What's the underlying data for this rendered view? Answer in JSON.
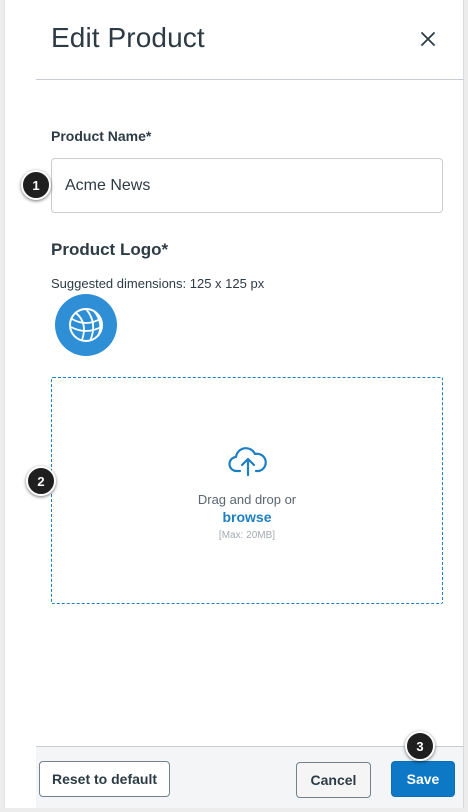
{
  "dialog": {
    "title": "Edit Product",
    "close_label": "×"
  },
  "form": {
    "product_name": {
      "label": "Product Name*",
      "value": "Acme News"
    },
    "product_logo": {
      "label": "Product Logo*",
      "hint": "Suggested dimensions: 125 x 125 px",
      "logo_icon": "globe-icon"
    },
    "dropzone": {
      "icon": "cloud-upload-icon",
      "text": "Drag and drop or",
      "browse_label": "browse",
      "max_size": "[Max: 20MB]"
    }
  },
  "footer": {
    "reset_label": "Reset to default",
    "cancel_label": "Cancel",
    "save_label": "Save"
  },
  "callouts": [
    "1",
    "2",
    "3"
  ],
  "colors": {
    "accent": "#1d7fc4",
    "save_button": "#0c78c6",
    "logo_background": "#2e8fd6",
    "text": "#2d3b45"
  }
}
